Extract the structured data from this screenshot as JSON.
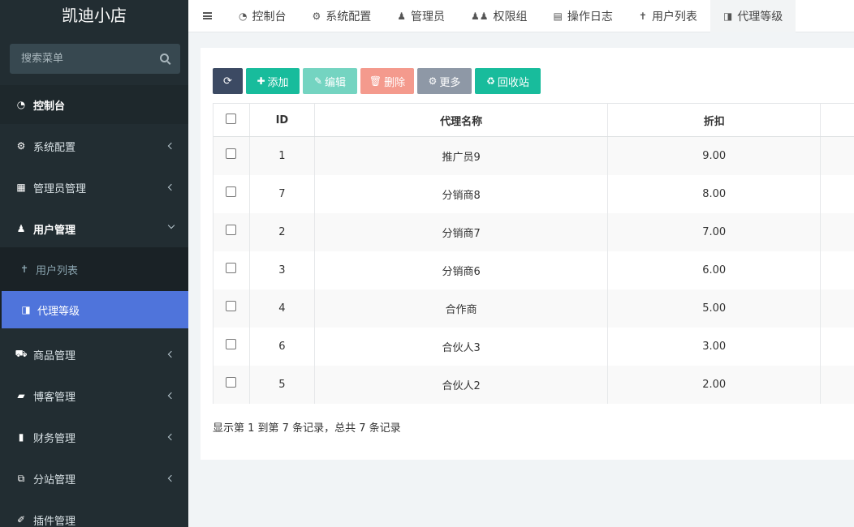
{
  "app": {
    "title": "凯迪小店"
  },
  "search": {
    "placeholder": "搜索菜单"
  },
  "sidebar": {
    "items": [
      {
        "label": "控制台",
        "icon": "dashboard-icon"
      },
      {
        "label": "系统配置",
        "icon": "cogs-icon"
      },
      {
        "label": "管理员管理",
        "icon": "windows-icon"
      },
      {
        "label": "用户管理",
        "icon": "user-icon"
      },
      {
        "label": "商品管理",
        "icon": "cart-icon"
      },
      {
        "label": "博客管理",
        "icon": "book-icon"
      },
      {
        "label": "财务管理",
        "icon": "bookmark-icon"
      },
      {
        "label": "分站管理",
        "icon": "clone-icon"
      },
      {
        "label": "插件管理",
        "icon": "plug-icon"
      }
    ],
    "sub_items": [
      {
        "label": "用户列表",
        "icon": "male-icon"
      },
      {
        "label": "代理等级",
        "icon": "trello-icon"
      }
    ]
  },
  "tabs": [
    {
      "label": "控制台",
      "icon": "dashboard-icon"
    },
    {
      "label": "系统配置",
      "icon": "cog-icon"
    },
    {
      "label": "管理员",
      "icon": "user-icon"
    },
    {
      "label": "权限组",
      "icon": "group-icon"
    },
    {
      "label": "操作日志",
      "icon": "list-alt-icon"
    },
    {
      "label": "用户列表",
      "icon": "male-icon"
    },
    {
      "label": "代理等级",
      "icon": "trello-icon"
    }
  ],
  "toolbar": {
    "add_label": "添加",
    "edit_label": "编辑",
    "delete_label": "删除",
    "more_label": "更多",
    "recycle_label": "回收站"
  },
  "table": {
    "headers": {
      "id": "ID",
      "name": "代理名称",
      "discount": "折扣"
    },
    "rows": [
      {
        "id": "1",
        "name": "推广员9",
        "discount": "9.00"
      },
      {
        "id": "7",
        "name": "分销商8",
        "discount": "8.00"
      },
      {
        "id": "2",
        "name": "分销商7",
        "discount": "7.00"
      },
      {
        "id": "3",
        "name": "分销商6",
        "discount": "6.00"
      },
      {
        "id": "4",
        "name": "合作商",
        "discount": "5.00"
      },
      {
        "id": "6",
        "name": "合伙人3",
        "discount": "3.00"
      },
      {
        "id": "5",
        "name": "合伙人2",
        "discount": "2.00"
      }
    ]
  },
  "pagination": {
    "summary": "显示第 1 到第 7 条记录，总共 7 条记录"
  },
  "colors": {
    "sidebar_bg": "#222d32",
    "selected_sub_bg": "#4f74db",
    "accent_green": "#18bc9c",
    "refresh_dark": "#3c4a63",
    "delete_red": "#f49a8d"
  }
}
